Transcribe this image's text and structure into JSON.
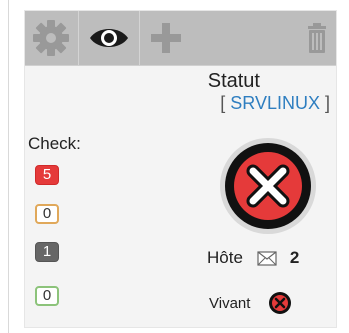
{
  "toolbar": {
    "buttons": [
      {
        "icon": "gear-icon"
      },
      {
        "icon": "eye-icon"
      },
      {
        "icon": "plus-icon"
      },
      {
        "icon": "trash-icon"
      }
    ]
  },
  "header": {
    "title": "Statut",
    "host_open": "[ ",
    "host": "SRVLINUX",
    "host_close": " ]"
  },
  "checks": {
    "label": "Check:",
    "counts": [
      {
        "value": "5",
        "color": "#e53a3a"
      },
      {
        "value": "0",
        "color": "#e0a85a"
      },
      {
        "value": "1",
        "color": "#666666"
      },
      {
        "value": "0",
        "color": "#8cc37a"
      }
    ]
  },
  "status": {
    "icon": "error-x-icon",
    "color": "#e53a3a"
  },
  "hote": {
    "label": "Hôte",
    "icon": "envelope-icon",
    "count": "2"
  },
  "vivant": {
    "label": "Vivant",
    "icon": "error-x-icon"
  }
}
